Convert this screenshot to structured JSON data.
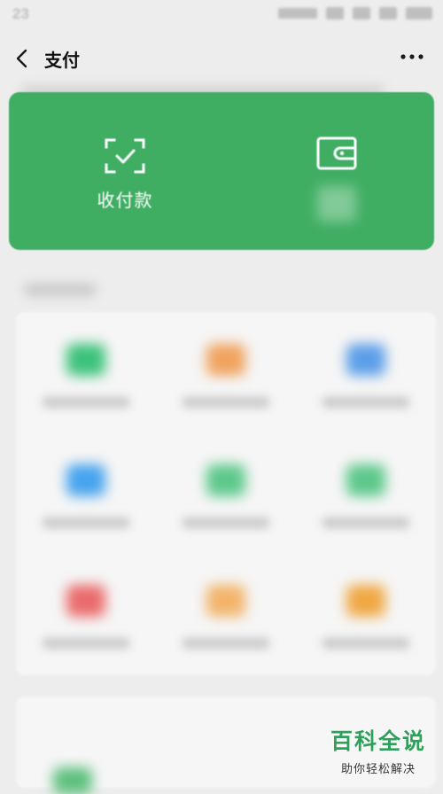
{
  "status_bar": {
    "time": "23"
  },
  "header": {
    "title": "支付",
    "back_icon": "chevron-left-icon",
    "more_icon": "more-dots-icon"
  },
  "green_card": {
    "background": "#3fae63",
    "pay_action": {
      "label": "收付款",
      "icon": "scan-frame-icon"
    },
    "wallet_action": {
      "icon": "wallet-icon"
    }
  },
  "services": {
    "icon_colors": [
      "#3cc27a",
      "#f0a35e",
      "#5b9ee8",
      "#46a3ee",
      "#5cc88a",
      "#5cc88a",
      "#ea6b6b",
      "#f2b46a",
      "#f0a844"
    ]
  },
  "watermark": {
    "main": "百科全说",
    "sub": "助你轻松解决",
    "color": "#2ea05a"
  }
}
